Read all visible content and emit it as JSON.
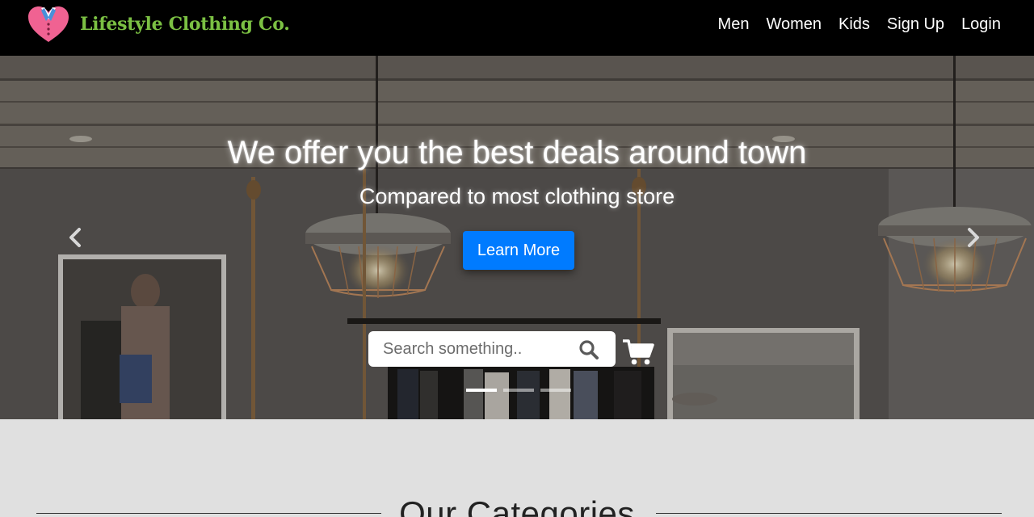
{
  "brand": {
    "name": "Lifestyle Clothing Co.",
    "logo_icon": "heart-shirt-icon"
  },
  "nav": {
    "links": [
      {
        "label": "Men"
      },
      {
        "label": "Women"
      },
      {
        "label": "Kids"
      },
      {
        "label": "Sign Up"
      },
      {
        "label": "Login"
      }
    ]
  },
  "hero": {
    "title": "We offer you the best deals around town",
    "subtitle": "Compared to most clothing store",
    "cta_label": "Learn More",
    "search_placeholder": "Search something..",
    "carousel_active_index": 0,
    "carousel_slide_count": 3
  },
  "categories": {
    "heading": "Our Categories"
  },
  "colors": {
    "navbar_bg": "#000000",
    "brand_text": "#7bc043",
    "cta_bg": "#007bff",
    "page_bg": "#e0e0e0"
  }
}
